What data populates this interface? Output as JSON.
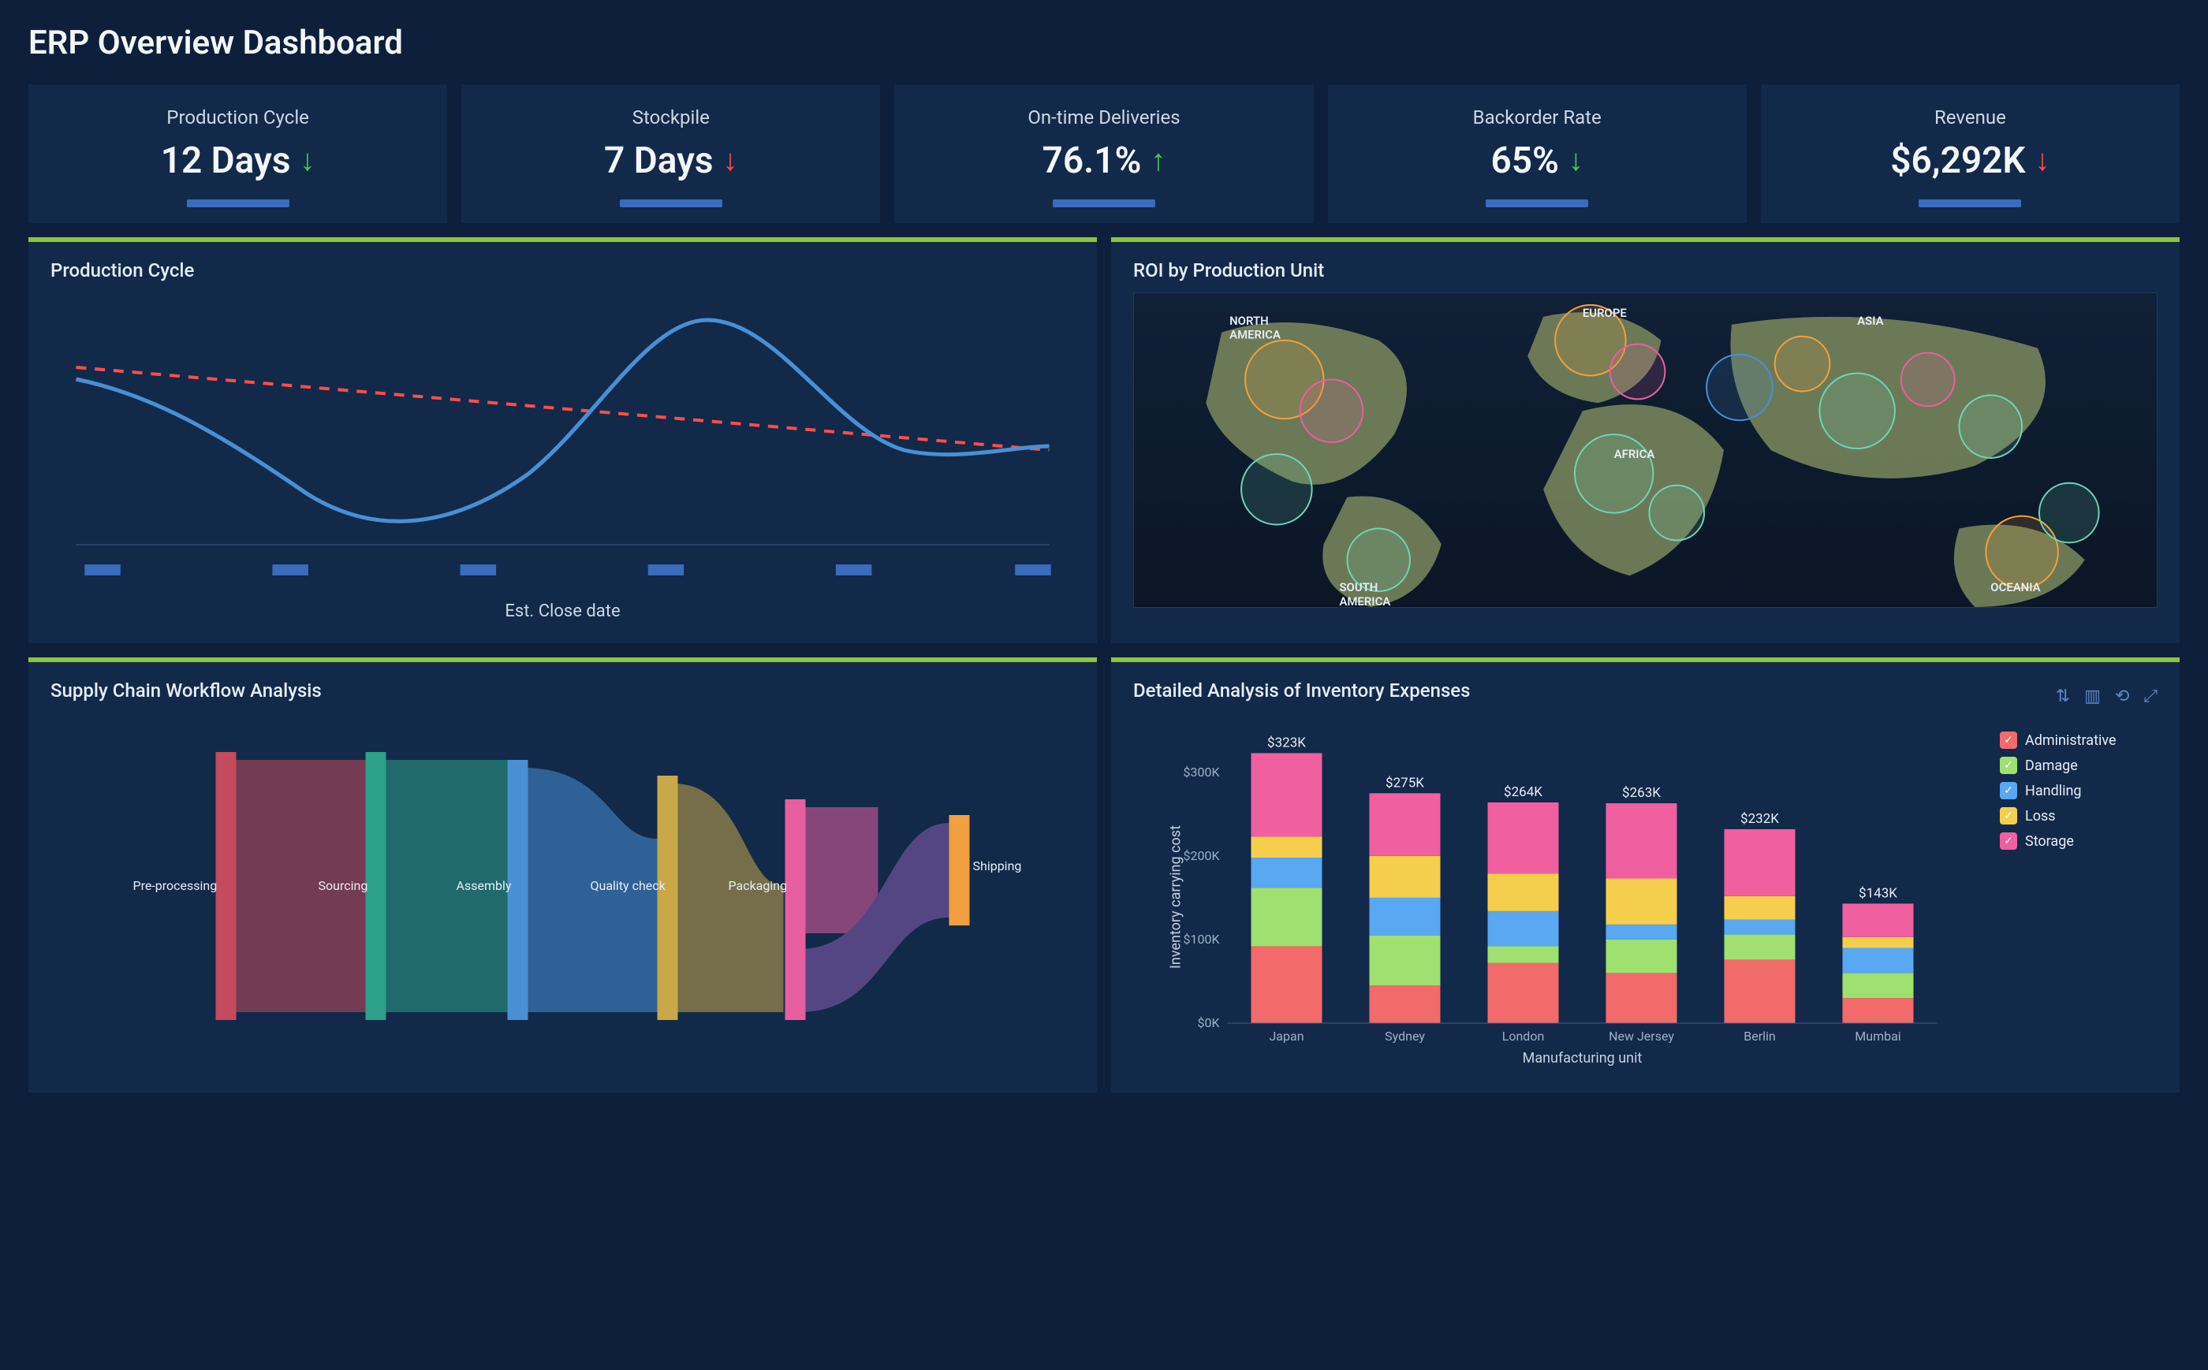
{
  "title": "ERP Overview Dashboard",
  "kpis": [
    {
      "label": "Production Cycle",
      "value": "12 Days",
      "trend": "down-green"
    },
    {
      "label": "Stockpile",
      "value": "7 Days",
      "trend": "down-red"
    },
    {
      "label": "On-time Deliveries",
      "value": "76.1%",
      "trend": "up-green"
    },
    {
      "label": "Backorder Rate",
      "value": "65%",
      "trend": "down-green"
    },
    {
      "label": "Revenue",
      "value": "$6,292K",
      "trend": "down-red"
    }
  ],
  "panels": {
    "production": {
      "title": "Production Cycle",
      "xlabel": "Est. Close date"
    },
    "roi": {
      "title": "ROI by Production Unit",
      "labels": [
        "NORTH AMERICA",
        "EUROPE",
        "ASIA",
        "AFRICA",
        "SOUTH AMERICA",
        "OCEANIA"
      ]
    },
    "sankey": {
      "title": "Supply Chain Workflow Analysis",
      "nodes": [
        "Pre-processing",
        "Sourcing",
        "Assembly",
        "Quality check",
        "Packaging",
        "Shipping"
      ]
    },
    "inventory": {
      "title": "Detailed Analysis of Inventory Expenses",
      "ylabel": "Inventory carrying cost",
      "xlabel": "Manufacturing unit",
      "legend": [
        "Administrative",
        "Damage",
        "Handling",
        "Loss",
        "Storage"
      ],
      "colors": {
        "Administrative": "#f36a6a",
        "Damage": "#9fe070",
        "Handling": "#5aa7f2",
        "Loss": "#f5cf4b",
        "Storage": "#f05fa0"
      }
    }
  },
  "chart_data": [
    {
      "type": "line",
      "title": "Production Cycle",
      "xlabel": "Est. Close date",
      "ylabel": "",
      "x_ticks": 6,
      "series": [
        {
          "name": "actual",
          "values": [
            62,
            52,
            30,
            24,
            34,
            95,
            60,
            48,
            50,
            51
          ]
        },
        {
          "name": "trend",
          "values": [
            68,
            65,
            62,
            59,
            55,
            52,
            49,
            46,
            44,
            44
          ],
          "style": "dashed",
          "color": "#ff4d4d"
        }
      ],
      "ylim": [
        0,
        100
      ]
    },
    {
      "type": "bar",
      "title": "Detailed Analysis of Inventory Expenses",
      "stacked": true,
      "xlabel": "Manufacturing unit",
      "ylabel": "Inventory carrying cost",
      "y_ticks": [
        "$0K",
        "$100K",
        "$200K",
        "$300K"
      ],
      "ylim": [
        0,
        330
      ],
      "categories": [
        "Japan",
        "Sydney",
        "London",
        "New Jersey",
        "Berlin",
        "Mumbai"
      ],
      "totals_label": [
        "$323K",
        "$275K",
        "$264K",
        "$263K",
        "$232K",
        "$143K"
      ],
      "series": [
        {
          "name": "Administrative",
          "values": [
            92,
            45,
            72,
            60,
            76,
            30
          ],
          "color": "#f36a6a"
        },
        {
          "name": "Damage",
          "values": [
            70,
            60,
            20,
            40,
            30,
            30
          ],
          "color": "#9fe070"
        },
        {
          "name": "Handling",
          "values": [
            36,
            45,
            42,
            18,
            18,
            30
          ],
          "color": "#5aa7f2"
        },
        {
          "name": "Loss",
          "values": [
            25,
            50,
            45,
            55,
            28,
            13
          ],
          "color": "#f5cf4b"
        },
        {
          "name": "Storage",
          "values": [
            100,
            75,
            85,
            90,
            80,
            40
          ],
          "color": "#f05fa0"
        }
      ]
    },
    {
      "type": "sankey",
      "title": "Supply Chain Workflow Analysis",
      "nodes": [
        "Pre-processing",
        "Sourcing",
        "Assembly",
        "Quality check",
        "Packaging",
        "Shipping"
      ],
      "node_colors": [
        "#c44a5d",
        "#2ca089",
        "#4a8fd4",
        "#c9a84a",
        "#e85fa0",
        "#f2a03d"
      ]
    },
    {
      "type": "map",
      "title": "ROI by Production Unit",
      "region_labels": [
        "NORTH AMERICA",
        "EUROPE",
        "ASIA",
        "AFRICA",
        "SOUTH AMERICA",
        "OCEANIA"
      ],
      "bubbles_count_approx": 20
    }
  ]
}
